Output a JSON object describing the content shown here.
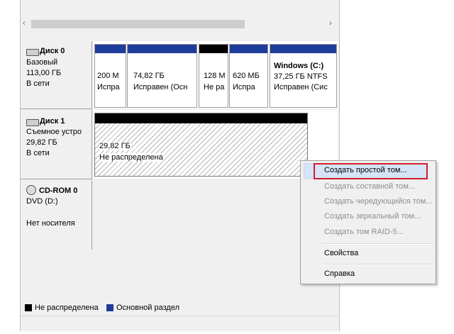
{
  "scrollbar": {
    "left_arrow": "‹",
    "right_arrow": "›"
  },
  "disks": [
    {
      "name": "Диск 0",
      "type": "Базовый",
      "size": "113,00 ГБ",
      "status": "В сети",
      "partitions": [
        {
          "size": "200 М",
          "status": "Испра"
        },
        {
          "size": "74,82 ГБ",
          "status": "Исправен (Осн"
        },
        {
          "size": "128 М",
          "status": "Не ра"
        },
        {
          "size": "620 МБ",
          "status": "Испра"
        },
        {
          "title": "Windows  (C:)",
          "size": "37,25 ГБ NTFS",
          "status": "Исправен (Сис"
        }
      ]
    },
    {
      "name": "Диск 1",
      "type": "Съемное устро",
      "size": "29,82 ГБ",
      "status": "В сети",
      "partitions": [
        {
          "size": "29,82 ГБ",
          "status": "Не распределена"
        }
      ]
    },
    {
      "name": "CD-ROM 0",
      "type": "DVD (D:)",
      "status": "Нет носителя"
    }
  ],
  "legend": [
    {
      "label": "Не распределена",
      "color": "#000000"
    },
    {
      "label": "Основной раздел",
      "color": "#1e3c9a"
    }
  ],
  "context_menu": {
    "items": [
      {
        "label": "Создать простой том...",
        "enabled": true,
        "highlighted": true
      },
      {
        "label": "Создать составной том...",
        "enabled": false
      },
      {
        "label": "Создать чередующийся том...",
        "enabled": false
      },
      {
        "label": "Создать зеркальный том...",
        "enabled": false
      },
      {
        "label": "Создать том RAID-5...",
        "enabled": false
      },
      {
        "label": "Свойства",
        "enabled": true
      },
      {
        "label": "Справка",
        "enabled": true
      }
    ]
  },
  "colors": {
    "primary_partition": "#1e3c9a",
    "unallocated": "#000000",
    "menu_highlight": "#d5e4f7",
    "callout": "#d01f2a"
  }
}
